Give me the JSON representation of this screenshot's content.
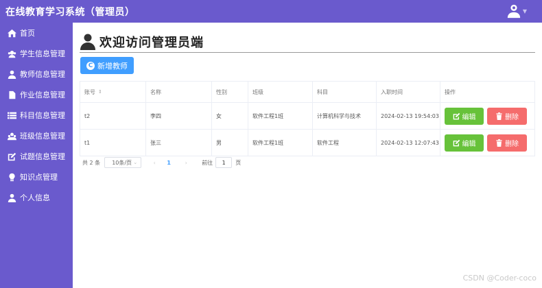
{
  "app": {
    "title": "在线教育学习系统（管理员）"
  },
  "sidebar": {
    "items": [
      {
        "label": "首页",
        "icon": "home-icon"
      },
      {
        "label": "学生信息管理",
        "icon": "students-icon"
      },
      {
        "label": "教师信息管理",
        "icon": "teacher-icon"
      },
      {
        "label": "作业信息管理",
        "icon": "file-icon"
      },
      {
        "label": "科目信息管理",
        "icon": "list-icon"
      },
      {
        "label": "班级信息管理",
        "icon": "group-icon"
      },
      {
        "label": "试题信息管理",
        "icon": "edit-icon"
      },
      {
        "label": "知识点管理",
        "icon": "bulb-icon"
      },
      {
        "label": "个人信息",
        "icon": "user-icon"
      }
    ]
  },
  "main": {
    "heading": "欢迎访问管理员端",
    "add_button": "新增教师",
    "table": {
      "headers": [
        "账号",
        "名称",
        "性别",
        "班级",
        "科目",
        "入职时间",
        "操作"
      ],
      "rows": [
        {
          "account": "t2",
          "name": "李四",
          "gender": "女",
          "class": "软件工程1班",
          "subject": "计算机科学与技术",
          "joined": "2024-02-13 19:54:03"
        },
        {
          "account": "t1",
          "name": "张三",
          "gender": "男",
          "class": "软件工程1班",
          "subject": "软件工程",
          "joined": "2024-02-13 12:07:43"
        }
      ],
      "edit_label": "编辑",
      "delete_label": "删除"
    },
    "pagination": {
      "total": "共 2 条",
      "page_size": "10条/页",
      "prev": "‹",
      "current_page": "1",
      "next": "›",
      "goto_label": "前往",
      "goto_value": "1",
      "goto_unit": "页"
    }
  },
  "watermark": "CSDN @Coder-coco",
  "colors": {
    "sidebar": "#6a5acd",
    "primary": "#409eff",
    "success": "#67c23a",
    "danger": "#f56c6c"
  }
}
